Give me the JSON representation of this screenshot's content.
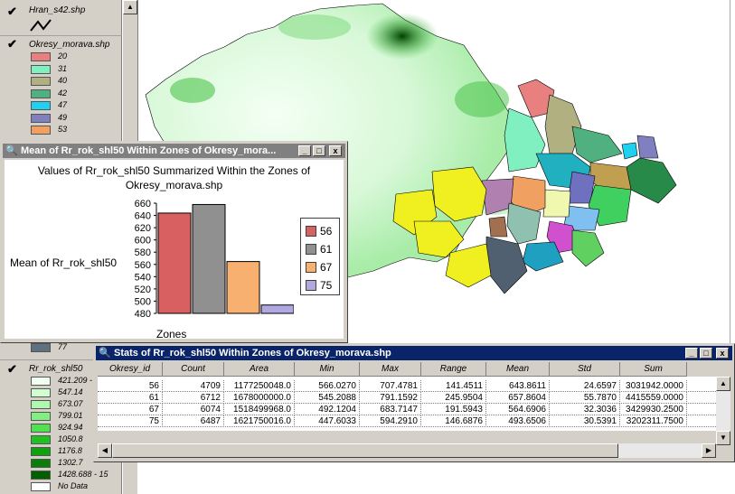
{
  "legend": {
    "layers": [
      {
        "name": "Hran_s42.shp",
        "checked": true
      },
      {
        "name": "Okresy_morava.shp",
        "checked": true,
        "classes": [
          {
            "label": "20",
            "color": "#e88080"
          },
          {
            "label": "31",
            "color": "#80f0c0"
          },
          {
            "label": "40",
            "color": "#b0b080"
          },
          {
            "label": "42",
            "color": "#50b080"
          },
          {
            "label": "47",
            "color": "#20d0f0"
          },
          {
            "label": "49",
            "color": "#8080c0"
          },
          {
            "label": "53",
            "color": "#f0a060"
          }
        ],
        "last_visible": "77"
      },
      {
        "name": "Rr_rok_shl50",
        "checked": true,
        "classes": [
          {
            "label": "421.209 -",
            "color": "#f0fff0"
          },
          {
            "label": "547.14",
            "color": "#d0ffd0"
          },
          {
            "label": "673.07",
            "color": "#b0f8b0"
          },
          {
            "label": "799.01",
            "color": "#80f080"
          },
          {
            "label": "924.94",
            "color": "#50e050"
          },
          {
            "label": "1050.8",
            "color": "#20c020"
          },
          {
            "label": "1176.8",
            "color": "#10a010"
          },
          {
            "label": "1302.7",
            "color": "#088008"
          },
          {
            "label": "1428.688 - 15",
            "color": "#006000"
          },
          {
            "label": "No Data",
            "color": "#ffffff"
          }
        ]
      }
    ]
  },
  "chart_window": {
    "title": "Mean of Rr_rok_shl50 Within Zones of Okresy_mora...",
    "buttons": [
      "_",
      "□",
      "x"
    ]
  },
  "chart_data": {
    "type": "bar",
    "title": "Values of Rr_rok_shl50 Summarized Within the Zones of Okresy_morava.shp",
    "ylabel": "Mean of Rr_rok_shl50",
    "xlabel": "Zones",
    "ylim": [
      480,
      660
    ],
    "yticks": [
      "660",
      "640",
      "620",
      "600",
      "580",
      "560",
      "540",
      "520",
      "500",
      "480"
    ],
    "series": [
      {
        "name": "56",
        "value": 643.8611,
        "color": "#d86060"
      },
      {
        "name": "61",
        "value": 657.8604,
        "color": "#909090"
      },
      {
        "name": "67",
        "value": 564.6906,
        "color": "#f8b070"
      },
      {
        "name": "75",
        "value": 493.6506,
        "color": "#b0a8e0"
      }
    ]
  },
  "stats_window": {
    "title": "Stats of Rr_rok_shl50 Within Zones of Okresy_morava.shp",
    "buttons": [
      "_",
      "□",
      "x"
    ],
    "columns": [
      "Okresy_id",
      "Count",
      "Area",
      "Min",
      "Max",
      "Range",
      "Mean",
      "Std",
      "Sum"
    ],
    "rows": [
      [
        "56",
        "4709",
        "1177250048.0",
        "566.0270",
        "707.4781",
        "141.4511",
        "643.8611",
        "24.6597",
        "3031942.0000"
      ],
      [
        "61",
        "6712",
        "1678000000.0",
        "545.2088",
        "791.1592",
        "245.9504",
        "657.8604",
        "55.7870",
        "4415559.0000"
      ],
      [
        "67",
        "6074",
        "1518499968.0",
        "492.1204",
        "683.7147",
        "191.5943",
        "564.6906",
        "32.3036",
        "3429930.2500"
      ],
      [
        "75",
        "6487",
        "1621750016.0",
        "447.6033",
        "594.2910",
        "146.6876",
        "493.6506",
        "30.5391",
        "3202311.7500"
      ]
    ]
  }
}
